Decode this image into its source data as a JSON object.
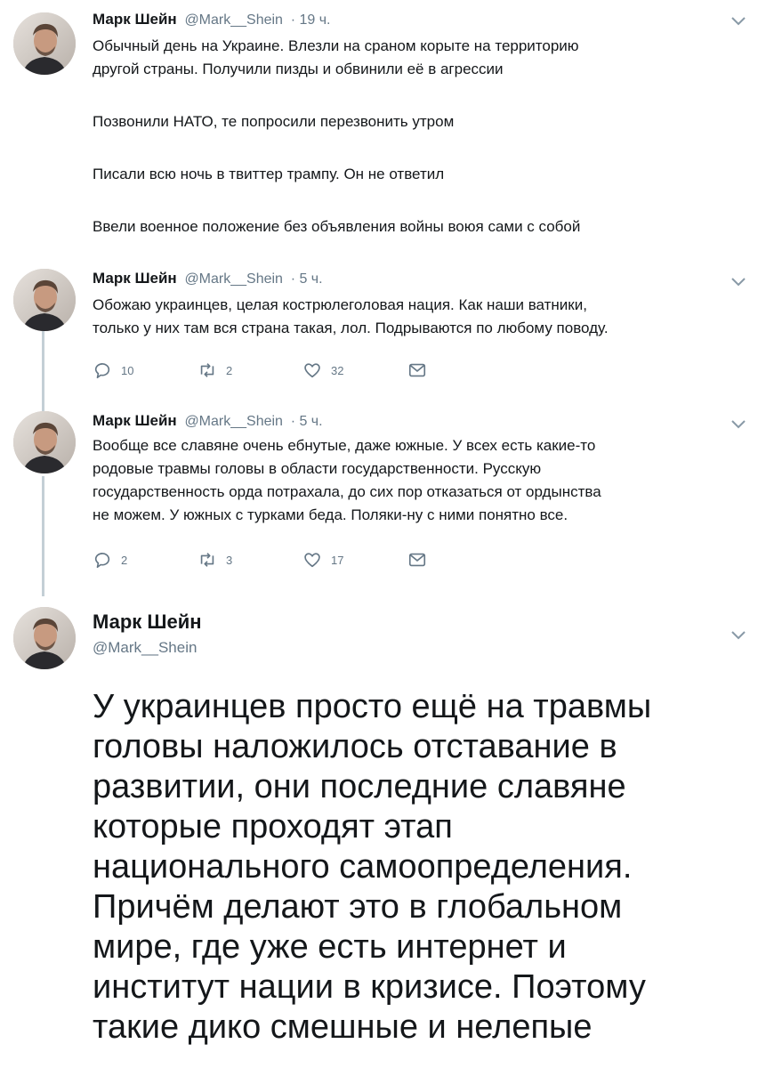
{
  "tweets": [
    {
      "name": "Марк Шейн",
      "handle": "@Mark__Shein",
      "time": "· 19 ч.",
      "paragraphs": [
        [
          "Обычный день на Украине. Влезли на сраном корыте на территорию",
          "другой страны. Получили пизды и обвинили её в агрессии"
        ],
        [
          "Позвонили НАТО, те попросили перезвонить утром"
        ],
        [
          "Писали всю ночь в твиттер трампу. Он не ответил"
        ],
        [
          "Ввели военное положение без объявления войны воюя сами с собой"
        ]
      ]
    },
    {
      "name": "Марк Шейн",
      "handle": "@Mark__Shein",
      "time": "· 5 ч.",
      "lines": [
        "Обожаю украинцев, целая кострюлеголовая нация. Как наши ватники,",
        "только у них там вся страна такая, лол. Подрываются по любому поводу."
      ],
      "replies": "10",
      "retweets": "2",
      "likes": "32"
    },
    {
      "name": "Марк Шейн",
      "handle": "@Mark__Shein",
      "time": "· 5 ч.",
      "lines": [
        "Вообще все славяне очень ебнутые, даже южные. У всех есть какие-то",
        "родовые травмы головы в области государственности. Русскую",
        "государственность орда потрахала, до сих пор отказаться от ордынства",
        "не можем. У южных с турками беда. Поляки-ну с ними понятно все."
      ],
      "replies": "2",
      "retweets": "3",
      "likes": "17"
    }
  ],
  "main_tweet": {
    "name": "Марк Шейн",
    "handle": "@Mark__Shein",
    "lines": [
      "У украинцев просто ещё на травмы",
      "головы наложилось отставание в",
      "развитии, они последние славяне",
      "которые проходят этап",
      "национального самоопределения.",
      "Причём делают это в глобальном",
      "мире, где уже есть интернет и",
      "институт нации в кризисе. Поэтому",
      "такие дико смешные и нелепые"
    ]
  },
  "icons": [
    "avatar",
    "chevron-down-icon",
    "reply-icon",
    "retweet-icon",
    "like-icon",
    "message-icon"
  ],
  "colors": {
    "text": "#14171a",
    "secondary": "#657786",
    "thread_line": "#c4cfd6"
  }
}
